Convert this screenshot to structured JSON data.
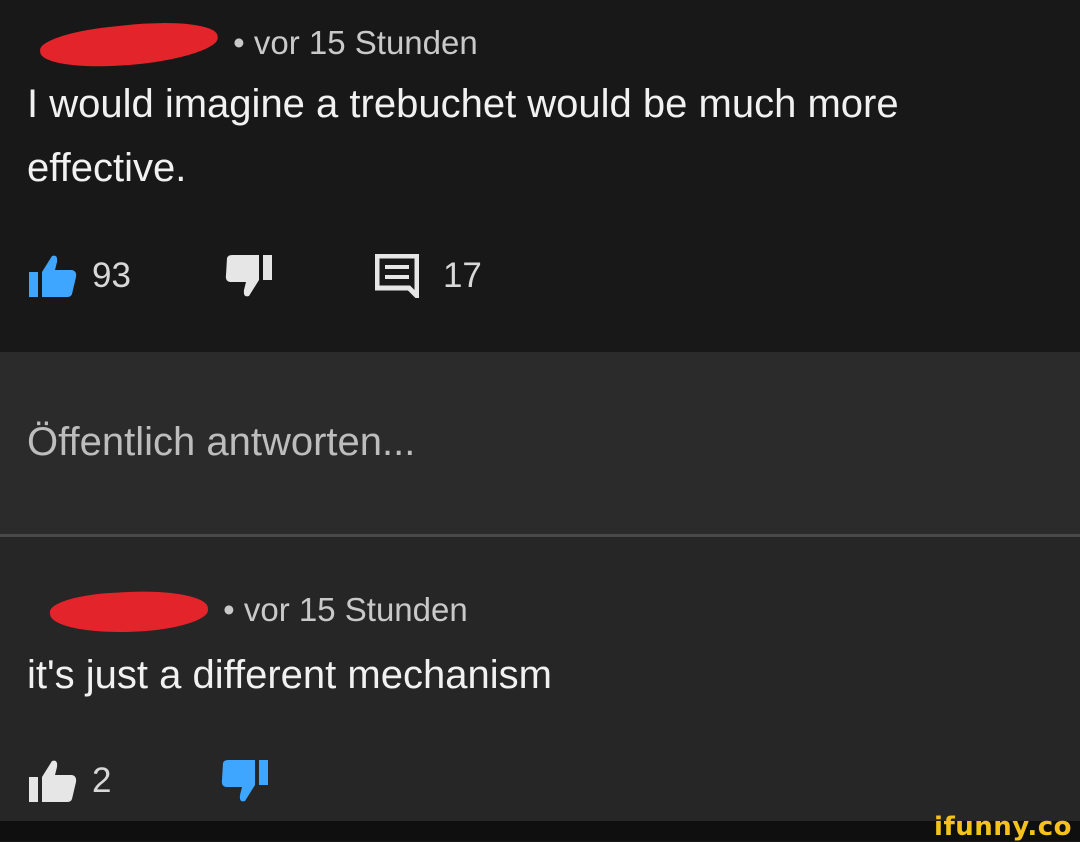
{
  "comments": [
    {
      "author_redacted": true,
      "timestamp": "• vor 15 Stunden",
      "text_line1": "I would imagine a trebuchet would be much more",
      "text_line2": "effective.",
      "likes": "93",
      "replies": "17",
      "like_state": "liked",
      "like_color": "#3ea6ff"
    },
    {
      "author_redacted": true,
      "timestamp": "• vor 15 Stunden",
      "text_line1": "it's just a different mechanism",
      "likes": "2",
      "like_state": "disliked",
      "dislike_color": "#3ea6ff"
    }
  ],
  "reply": {
    "placeholder": "Öffentlich antworten..."
  },
  "watermark": "ifunny.co",
  "colors": {
    "background": "#181818",
    "reply_background": "#2b2b2b",
    "second_comment_background": "#262626",
    "redaction": "#e3242b",
    "accent_blue": "#3ea6ff",
    "watermark": "#f4c21b"
  }
}
